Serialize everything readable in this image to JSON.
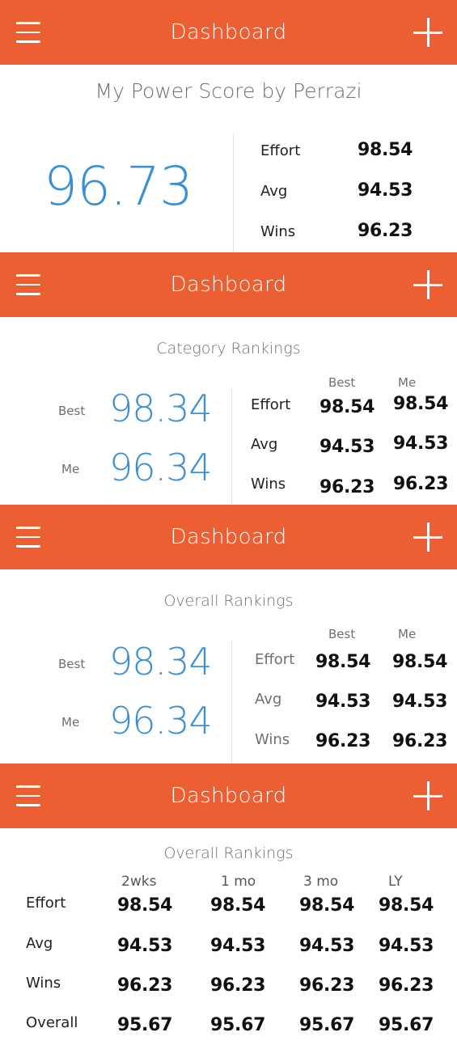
{
  "panel1": {
    "header_title": "Dashboard",
    "title": "My Power Score by Perrazi",
    "score": "96.73",
    "rows": [
      {
        "label": "Effort",
        "value": "98.54"
      },
      {
        "label": "Avg",
        "value": "94.53"
      },
      {
        "label": "Wins",
        "value": "96.23"
      }
    ]
  },
  "panel2": {
    "header_title": "Dashboard",
    "title": "Category Rankings",
    "best_label": "Best",
    "best_value": "98.34",
    "me_label": "Me",
    "me_value": "96.34",
    "col_best": "Best",
    "col_me": "Me",
    "rows": [
      {
        "label": "Effort",
        "best": "98.54",
        "me": "98.54"
      },
      {
        "label": "Avg",
        "best": "94.53",
        "me": "94.53"
      },
      {
        "label": "Wins",
        "best": "96.23",
        "me": "96.23"
      }
    ]
  },
  "panel3": {
    "header_title": "Dashboard",
    "title": "Overall Rankings",
    "best_label": "Best",
    "best_value": "98.34",
    "me_label": "Me",
    "me_value": "96.34",
    "col_best": "Best",
    "col_me": "Me",
    "rows": [
      {
        "label": "Effort",
        "best": "98.54",
        "me": "98.54"
      },
      {
        "label": "Avg",
        "best": "94.53",
        "me": "94.53"
      },
      {
        "label": "Wins",
        "best": "96.23",
        "me": "96.23"
      }
    ]
  },
  "panel4": {
    "header_title": "Dashboard",
    "title": "Overall Rankings",
    "columns": [
      "2wks",
      "1 mo",
      "3 mo",
      "LY"
    ],
    "rows": [
      {
        "label": "Effort",
        "values": [
          "98.54",
          "98.54",
          "98.54",
          "98.54"
        ]
      },
      {
        "label": "Avg",
        "values": [
          "94.53",
          "94.53",
          "94.53",
          "94.53"
        ]
      },
      {
        "label": "Wins",
        "values": [
          "96.23",
          "96.23",
          "96.23",
          "96.23"
        ]
      },
      {
        "label": "Overall",
        "values": [
          "95.67",
          "95.67",
          "95.67",
          "95.67"
        ]
      }
    ]
  },
  "colors": {
    "header": "#ec5f33",
    "score_blue": "#3b8fd4"
  },
  "icons": [
    "hamburger-menu-icon",
    "plus-icon"
  ]
}
